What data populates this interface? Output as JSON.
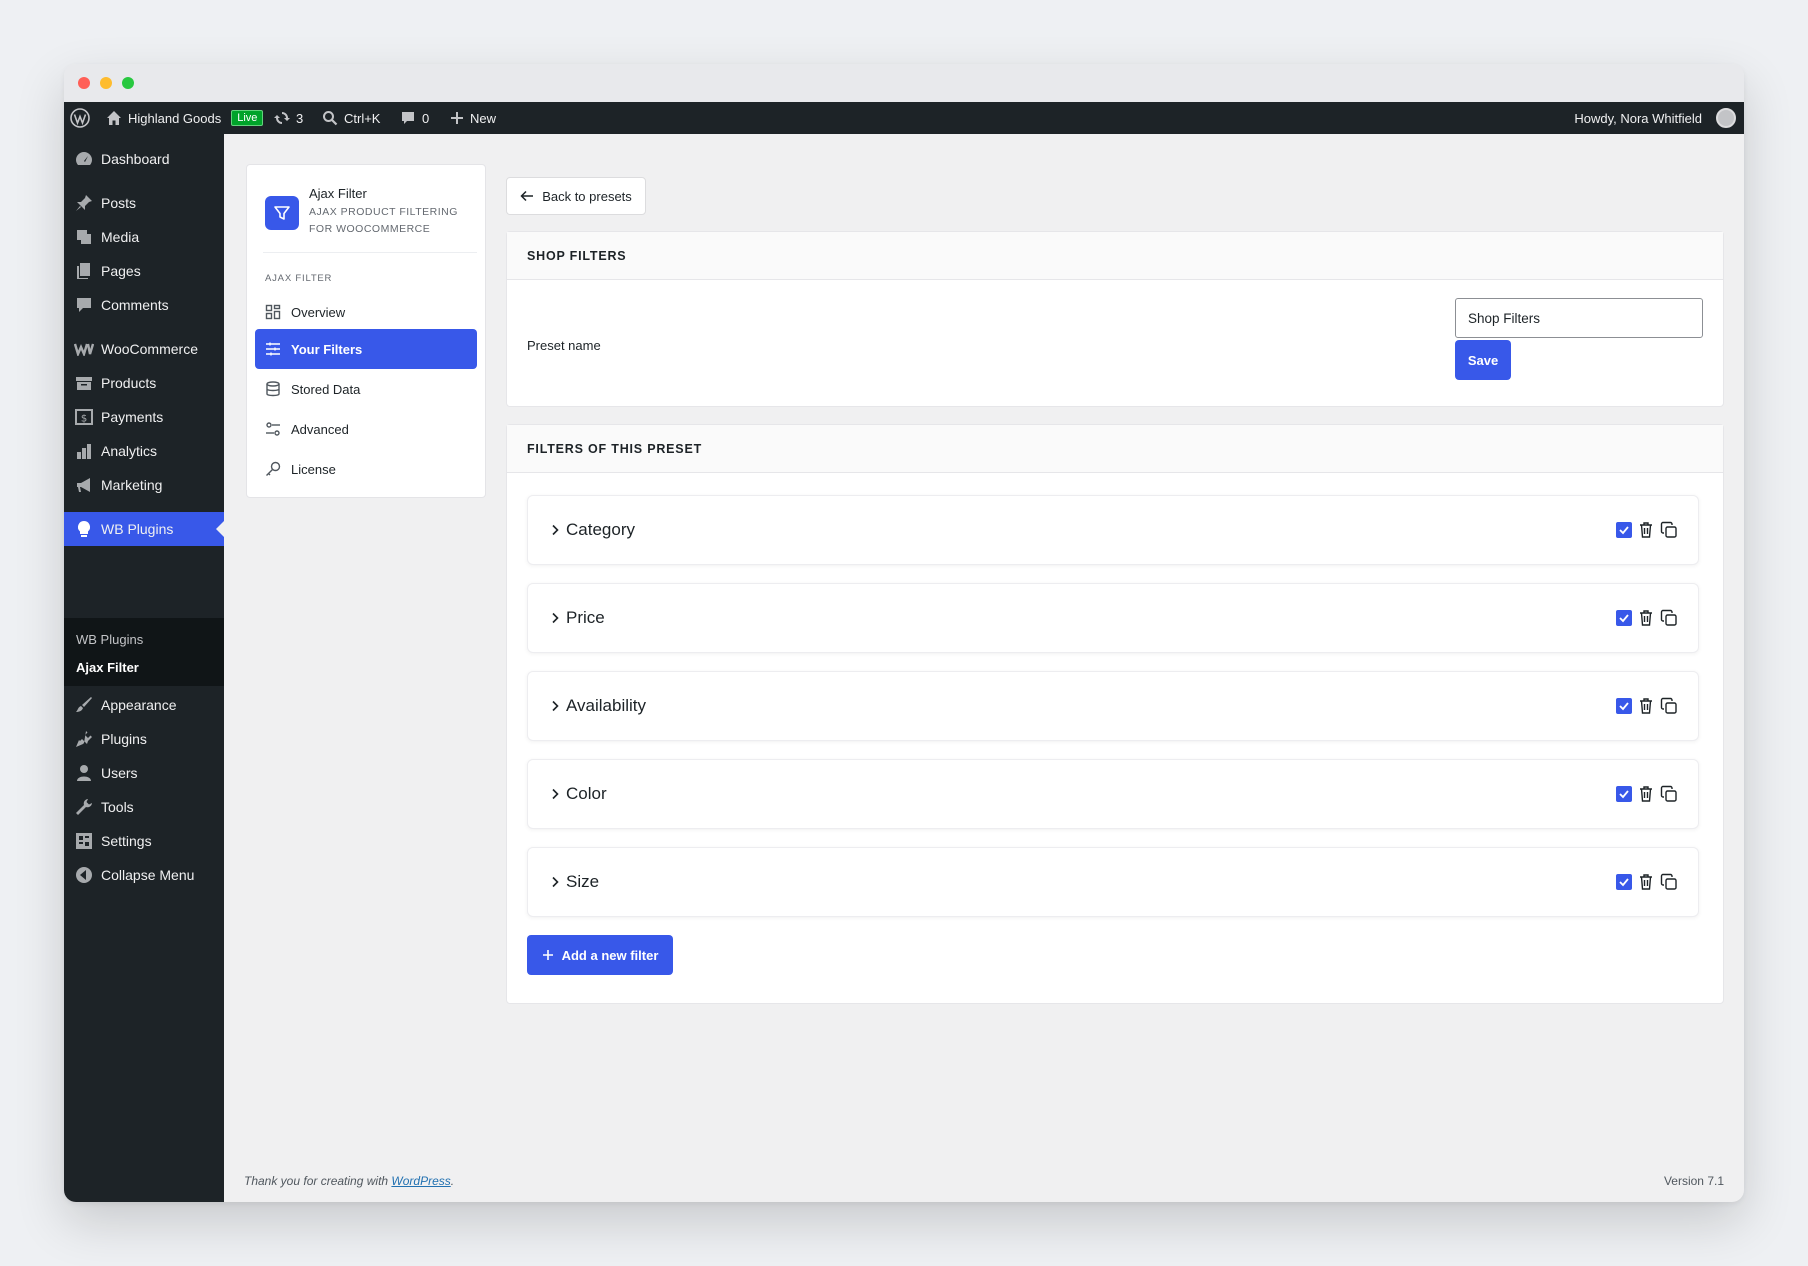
{
  "adminbar": {
    "site_name": "Highland Goods",
    "live_badge": "Live",
    "updates_count": "3",
    "search_shortcut": "Ctrl+K",
    "comments_count": "0",
    "new_label": "New",
    "howdy": "Howdy, Nora Whitfield"
  },
  "sidebar": {
    "items": [
      {
        "label": "Dashboard",
        "icon": "dashboard-icon"
      },
      {
        "label": "Posts",
        "icon": "pin-icon"
      },
      {
        "label": "Media",
        "icon": "media-icon"
      },
      {
        "label": "Pages",
        "icon": "pages-icon"
      },
      {
        "label": "Comments",
        "icon": "comment-icon"
      },
      {
        "label": "WooCommerce",
        "icon": "woo-icon"
      },
      {
        "label": "Products",
        "icon": "archive-icon"
      },
      {
        "label": "Payments",
        "icon": "payment-icon"
      },
      {
        "label": "Analytics",
        "icon": "bar-chart-icon"
      },
      {
        "label": "Marketing",
        "icon": "megaphone-icon"
      },
      {
        "label": "WB Plugins",
        "icon": "lightbulb-icon"
      },
      {
        "label": "Appearance",
        "icon": "brush-icon"
      },
      {
        "label": "Plugins",
        "icon": "plugin-icon"
      },
      {
        "label": "Users",
        "icon": "user-icon"
      },
      {
        "label": "Tools",
        "icon": "wrench-icon"
      },
      {
        "label": "Settings",
        "icon": "settings-icon"
      },
      {
        "label": "Collapse Menu",
        "icon": "collapse-icon"
      }
    ],
    "submenu": [
      "WB Plugins",
      "Ajax Filter"
    ]
  },
  "plugin_nav": {
    "title": "Ajax Filter",
    "subtitle": "AJAX PRODUCT FILTERING FOR WOOCOMMERCE",
    "section": "AJAX FILTER",
    "items": [
      "Overview",
      "Your Filters",
      "Stored Data",
      "Advanced",
      "License"
    ]
  },
  "main": {
    "back_label": "Back to presets",
    "shop_filters_title": "SHOP FILTERS",
    "preset_label": "Preset name",
    "preset_value": "Shop Filters",
    "save_label": "Save",
    "filters_title": "FILTERS OF THIS PRESET",
    "filters": [
      "Category",
      "Price",
      "Availability",
      "Color",
      "Size"
    ],
    "add_label": "Add a new filter"
  },
  "footer": {
    "thanks_prefix": "Thank you for creating with ",
    "wp_link": "WordPress",
    "thanks_suffix": ".",
    "version": "Version 7.1"
  },
  "colors": {
    "accent": "#3858e9",
    "admin_dark": "#1d2327"
  }
}
